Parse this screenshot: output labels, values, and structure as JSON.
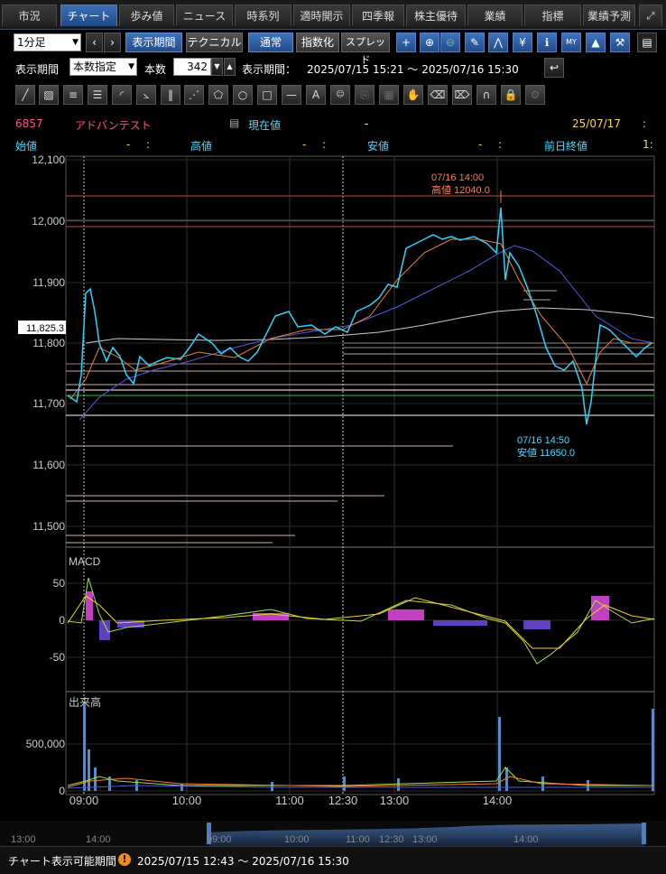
{
  "tabs": [
    {
      "label": "市況",
      "active": false
    },
    {
      "label": "チャート",
      "active": true
    },
    {
      "label": "歩み値",
      "active": false
    },
    {
      "label": "ニュース",
      "active": false
    },
    {
      "label": "時系列",
      "active": false
    },
    {
      "label": "適時開示",
      "active": false
    },
    {
      "label": "四季報",
      "active": false
    },
    {
      "label": "株主優待",
      "active": false
    },
    {
      "label": "業績",
      "active": false
    },
    {
      "label": "指標",
      "active": false
    },
    {
      "label": "業績予測",
      "active": false
    }
  ],
  "toolbar": {
    "interval": "1分足",
    "period_button": "表示期間",
    "technical_button": "テクニカル",
    "normal_button": "通常",
    "index_button": "指数化",
    "spread_button": "スプレッド"
  },
  "period_row": {
    "label": "表示期間",
    "mode": "本数指定",
    "count_label": "本数",
    "count_value": "342",
    "range_label": "表示期間：",
    "range_value": "2025/07/15 15:21 ～ 2025/07/16 15:30"
  },
  "quote": {
    "code": "6857",
    "name": "アドバンテスト",
    "current_label": "現在値",
    "current_value": "-",
    "date": "25/07/17",
    "date_sep": ":",
    "open_label": "始値",
    "open_value": "-",
    "open_time": ":",
    "high_label": "高値",
    "high_value": "-",
    "high_time": ":",
    "low_label": "安値",
    "low_value": "-",
    "low_time": ":",
    "prev_label": "前日終値",
    "prev_value": "1:"
  },
  "price_chart": {
    "yticks": [
      "12,100",
      "12,000",
      "11,900",
      "11,800",
      "11,700",
      "11,600",
      "11,500"
    ],
    "current_price_label": "11,825.3",
    "high_annotation_time": "07/16 14:00",
    "high_annotation_value": "高値 12040.0",
    "low_annotation_time": "07/16 14:50",
    "low_annotation_value": "安値 11650.0"
  },
  "macd": {
    "title": "MACD",
    "yticks": [
      "50",
      "0",
      "-50"
    ]
  },
  "volume": {
    "title": "出来高",
    "yticks": [
      "500,000",
      "0"
    ]
  },
  "xaxis": [
    "09:00",
    "10:00",
    "11:00",
    "12:30",
    "13:00",
    "14:00"
  ],
  "navigator": {
    "labels": [
      "13:00",
      "14:00",
      "09:00",
      "10:00",
      "11:00",
      "12:30",
      "13:00",
      "14:00"
    ]
  },
  "footer": {
    "label": "チャート表示可能期間",
    "range": "2025/07/15 12:43 ～ 2025/07/16 15:30"
  },
  "colors": {
    "up": "#2ad4ff",
    "down": "#ffffff",
    "high_line": "#ff6a4a",
    "low_line": "#ff9090",
    "macd_pos": "#c040c0",
    "macd_neg": "#6040c0"
  }
}
